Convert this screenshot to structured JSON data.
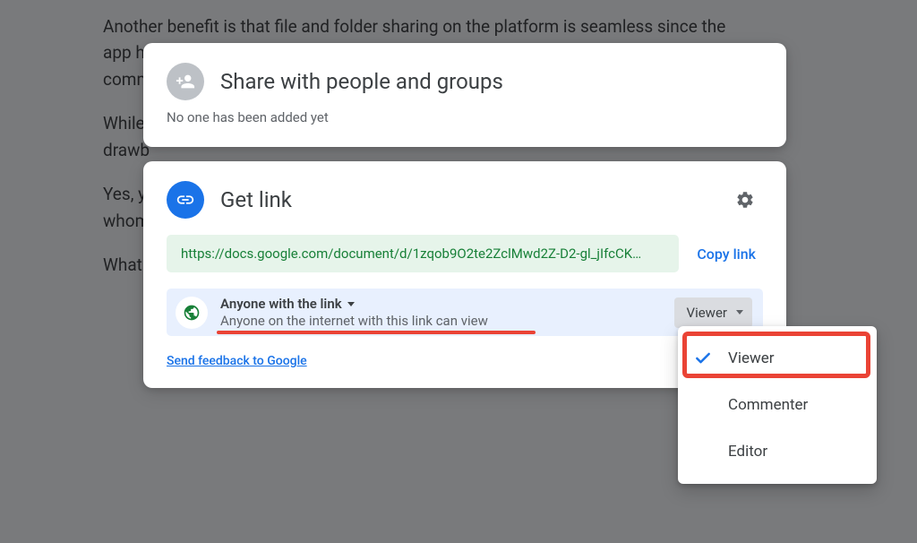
{
  "bg": {
    "p1": "Another benefit is that file and folder sharing on the platform is seamless since the app has this fantastic ability to do so with others. You can allow them access to view, comment, or edit the file by",
    "p2": "While this is a good thing, it can also become unfavorable. Let's take a look at some drawb",
    "p3": "Yes, you can share your Google files with anyone, but how do you protect it from those whom you de",
    "p4": "What"
  },
  "share": {
    "title": "Share with people and groups",
    "subtitle": "No one has been added yet"
  },
  "link": {
    "title": "Get link",
    "url": "https://docs.google.com/document/d/1zqob9O2te2ZclMwd2Z-D2-gl_jIfcCK…",
    "copy": "Copy link",
    "anyone_label": "Anyone with the link",
    "anyone_desc": "Anyone on the internet with this link can view",
    "role": "Viewer",
    "feedback": "Send feedback to Google"
  },
  "roles": {
    "viewer": "Viewer",
    "commenter": "Commenter",
    "editor": "Editor"
  }
}
